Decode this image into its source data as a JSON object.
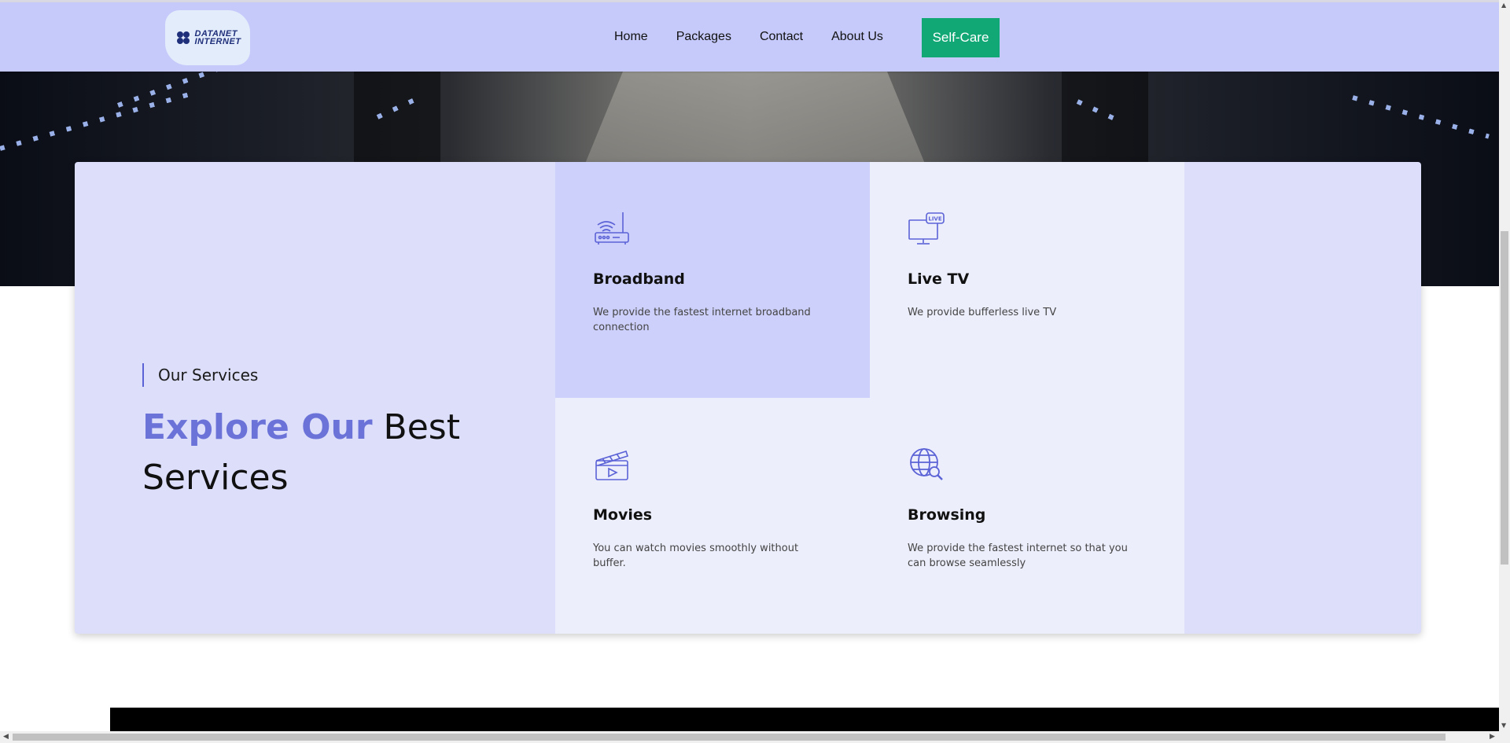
{
  "header": {
    "logo_line1": "DATANET",
    "logo_line2": "INTERNET",
    "nav": [
      "Home",
      "Packages",
      "Contact",
      "About Us"
    ],
    "cta_label": "Self-Care"
  },
  "services": {
    "eyebrow": "Our Services",
    "title_accent": "Explore Our",
    "title_rest": " Best Services",
    "items": [
      {
        "title": "Broadband",
        "desc": "We provide the fastest internet broadband connection",
        "icon": "router-icon"
      },
      {
        "title": "Live TV",
        "desc": "We provide bufferless live TV",
        "icon": "live-tv-icon"
      },
      {
        "title": "Movies",
        "desc": "You can watch movies smoothly without buffer.",
        "icon": "clapperboard-icon"
      },
      {
        "title": "Browsing",
        "desc": "We provide the fastest internet so that you can browse seamlessly",
        "icon": "globe-search-icon"
      }
    ],
    "live_badge": "LIVE"
  },
  "colors": {
    "header_bg": "#c5cafa",
    "accent": "#6b73d8",
    "cta": "#12a876",
    "card_bg": "#dcdefa"
  }
}
